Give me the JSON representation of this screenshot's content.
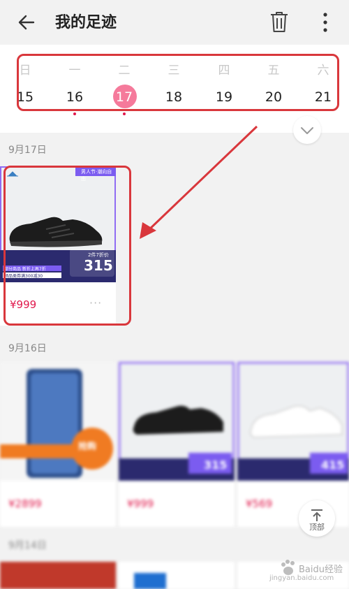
{
  "header": {
    "title": "我的足迹"
  },
  "calendar": {
    "weekdays": [
      "日",
      "一",
      "二",
      "三",
      "四",
      "五",
      "六"
    ],
    "days": [
      "15",
      "16",
      "17",
      "18",
      "19",
      "20",
      "21"
    ],
    "selected_day": "17"
  },
  "sections": [
    {
      "date_label": "9月17日",
      "items": [
        {
          "price": "¥999",
          "banner_top": "男人节·潮向自由",
          "badge_price": "315",
          "badge_note": "2件7折价",
          "promo1": "部分商品 新折上再7折",
          "promo2": "领品类券满300减30"
        }
      ]
    },
    {
      "date_label": "9月16日",
      "items": [
        {
          "price": "¥2899",
          "promo": "抢购"
        },
        {
          "price": "¥999",
          "badge_price": "315"
        },
        {
          "price": "¥569",
          "badge_price": "415"
        }
      ]
    },
    {
      "date_label": "9月14日"
    }
  ],
  "scroll_top": {
    "label": "顶部"
  },
  "watermark": {
    "text": "Baidu经验",
    "url": "jingyan.baidu.com"
  },
  "colors": {
    "accent": "#e0194c",
    "selected": "#f57a9b",
    "annotation": "#d9373c",
    "promo_purple": "#7b5cf0"
  }
}
